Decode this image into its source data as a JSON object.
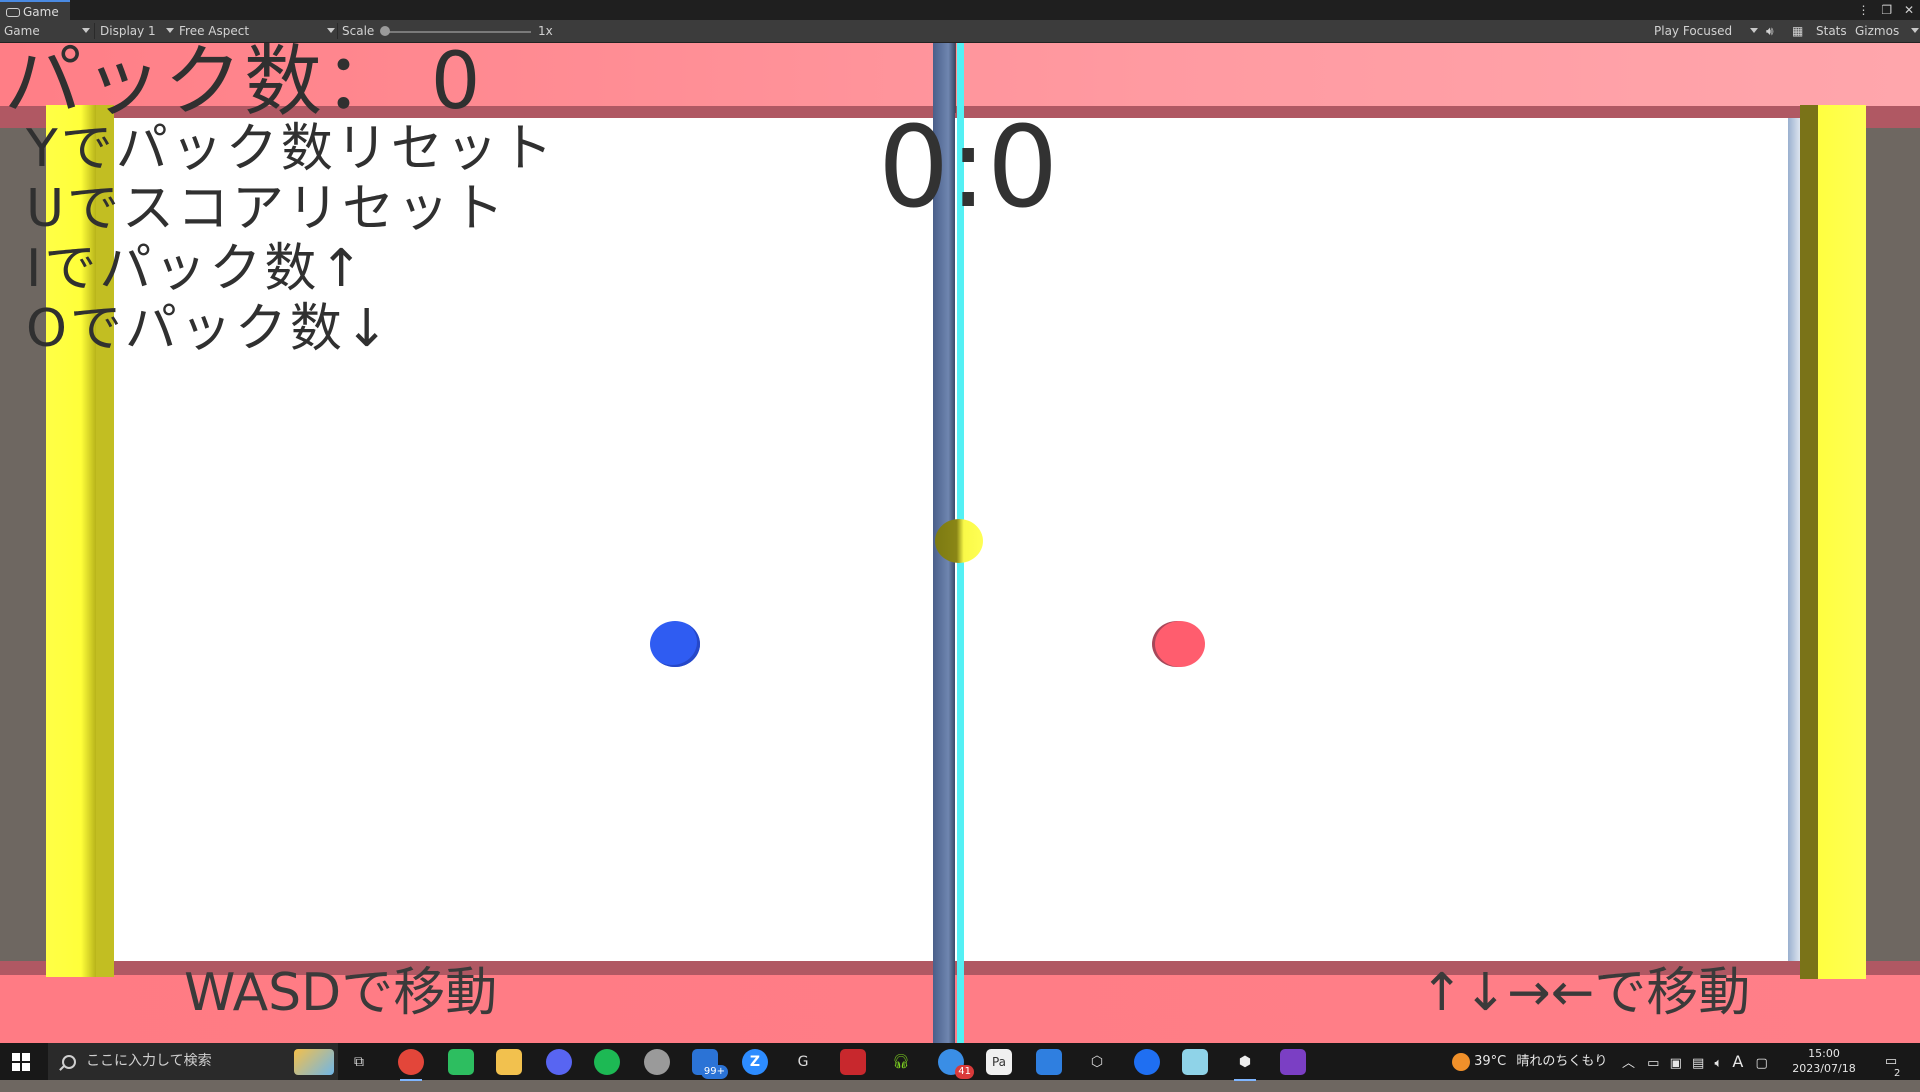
{
  "editor": {
    "tab_label": "Game",
    "view_mode": "Game",
    "display": "Display 1",
    "aspect": "Free Aspect",
    "scale_label": "Scale",
    "scale_value": "1x",
    "play_mode": "Play Focused",
    "stats_label": "Stats",
    "gizmos_label": "Gizmos"
  },
  "hud": {
    "puck_count": "パック数： 0",
    "help_lines": [
      "Yでパック数リセット",
      "Uでスコアリセット",
      "Iでパック数↑",
      "Oでパック数↓"
    ],
    "score": "0:0",
    "left_move": "WASDで移動",
    "right_move": "↑↓→←で移動"
  },
  "colors": {
    "wall": "#ff7e86",
    "goal": "#ffff46",
    "center_line": "#54f0f4",
    "mallet_blue": "#2f5cf2",
    "mallet_red": "#ff5d6e",
    "puck": "#ffff55"
  },
  "taskbar": {
    "search_placeholder": "ここに入力して検索",
    "apps": [
      {
        "icon": "chrome-icon",
        "badge": ""
      },
      {
        "icon": "evernote-icon",
        "badge": ""
      },
      {
        "icon": "file-explorer-icon",
        "badge": ""
      },
      {
        "icon": "discord-icon",
        "badge": ""
      },
      {
        "icon": "spotify-icon",
        "badge": ""
      },
      {
        "icon": "app-icon",
        "badge": ""
      },
      {
        "icon": "mail-icon",
        "badge": "99+"
      },
      {
        "icon": "zoom-icon",
        "badge": ""
      },
      {
        "icon": "logitech-icon",
        "badge": ""
      },
      {
        "icon": "keyboard-icon",
        "badge": ""
      },
      {
        "icon": "headset-icon",
        "badge": ""
      },
      {
        "icon": "browser-icon",
        "badge": "41"
      },
      {
        "icon": "paint-icon",
        "badge": ""
      },
      {
        "icon": "calendar-icon",
        "badge": ""
      },
      {
        "icon": "unity-hub-icon",
        "badge": ""
      },
      {
        "icon": "maps-icon",
        "badge": ""
      },
      {
        "icon": "notes-icon",
        "badge": ""
      },
      {
        "icon": "unity-icon",
        "badge": ""
      },
      {
        "icon": "visual-studio-icon",
        "badge": ""
      }
    ],
    "weather_temp": "39°C",
    "weather_text": "晴れのちくもり",
    "ime": "A",
    "time": "15:00",
    "date": "2023/07/18",
    "notifications": "2"
  }
}
